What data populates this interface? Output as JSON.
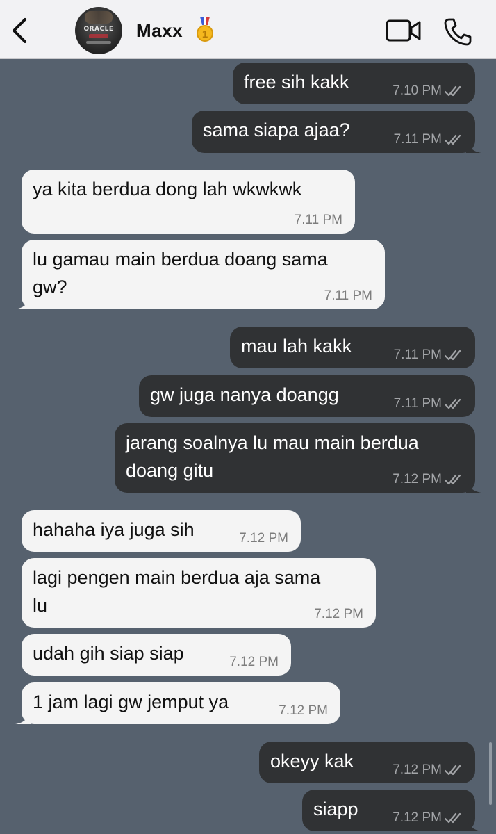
{
  "header": {
    "contact_name": "Maxx",
    "avatar_text": "ORACLE",
    "icons": {
      "back": "chevron-left-icon",
      "medal": "gold-medal-1-icon",
      "video": "video-camera-icon",
      "call": "phone-icon"
    }
  },
  "colors": {
    "background": "#56616e",
    "outgoing_bubble": "#303234",
    "incoming_bubble": "#f4f4f4",
    "header": "#f2f2f4"
  },
  "messages": [
    {
      "direction": "out",
      "text": "free sih kakk",
      "time": "7.10 PM",
      "read": true
    },
    {
      "direction": "out",
      "text": "sama siapa ajaa?",
      "time": "7.11 PM",
      "read": true
    },
    {
      "direction": "in",
      "text": "ya kita berdua dong lah wkwkwk",
      "time": "7.11 PM"
    },
    {
      "direction": "in",
      "text": "lu gamau main berdua doang sama\ngw?",
      "time": "7.11 PM"
    },
    {
      "direction": "out",
      "text": "mau lah kakk",
      "time": "7.11 PM",
      "read": true
    },
    {
      "direction": "out",
      "text": "gw juga nanya doangg",
      "time": "7.11 PM",
      "read": true
    },
    {
      "direction": "out",
      "text": "jarang soalnya lu mau main berdua\ndoang gitu",
      "time": "7.12 PM",
      "read": true
    },
    {
      "direction": "in",
      "text": "hahaha iya juga sih",
      "time": "7.12 PM"
    },
    {
      "direction": "in",
      "text": "lagi pengen main berdua aja sama\nlu",
      "time": "7.12 PM"
    },
    {
      "direction": "in",
      "text": "udah gih siap siap",
      "time": "7.12 PM"
    },
    {
      "direction": "in",
      "text": "1 jam lagi gw jemput ya",
      "time": "7.12 PM"
    },
    {
      "direction": "out",
      "text": "okeyy kak",
      "time": "7.12 PM",
      "read": true
    },
    {
      "direction": "out",
      "text": "siapp",
      "time": "7.12 PM",
      "read": true
    }
  ]
}
